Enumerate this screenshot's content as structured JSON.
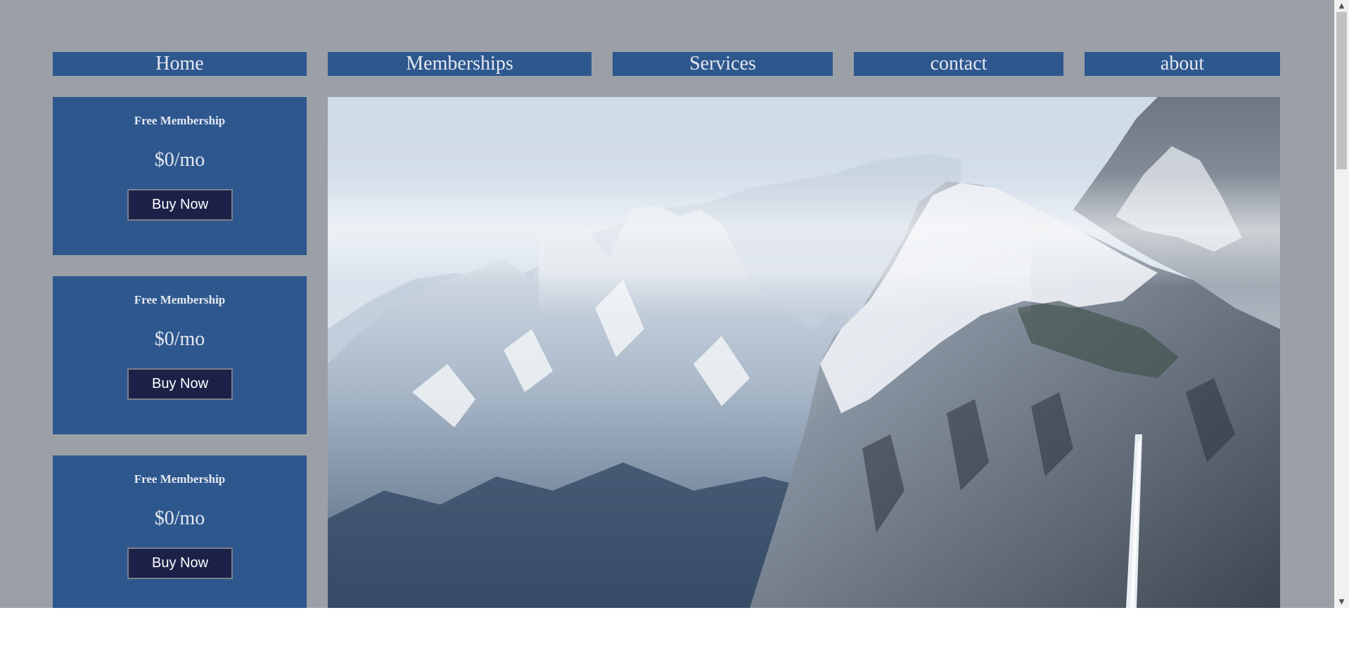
{
  "nav": {
    "items": [
      {
        "label": "Home"
      },
      {
        "label": "Memberships"
      },
      {
        "label": "Services"
      },
      {
        "label": "contact"
      },
      {
        "label": "about"
      }
    ]
  },
  "memberships": [
    {
      "title": "Free Membership",
      "price": "$0/mo",
      "button": "Buy Now"
    },
    {
      "title": "Free Membership",
      "price": "$0/mo",
      "button": "Buy Now"
    },
    {
      "title": "Free Membership",
      "price": "$0/mo",
      "button": "Buy Now"
    }
  ],
  "hero": {
    "image": "snowy-mountain-landscape"
  },
  "colors": {
    "page_background": "#9ba0a7",
    "panel_blue": "#2e578e",
    "button_navy": "#1b2147",
    "panel_text": "#e4e9f0"
  }
}
